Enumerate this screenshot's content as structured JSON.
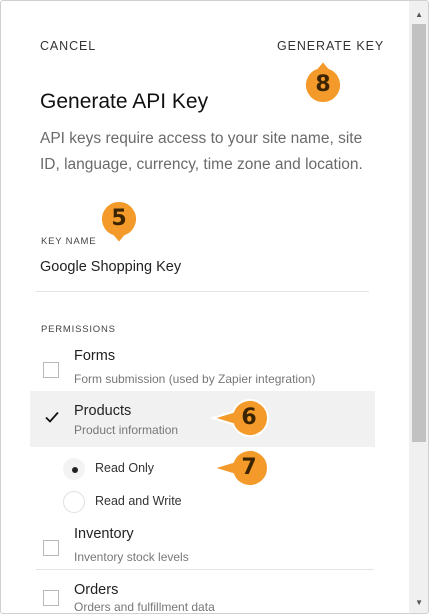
{
  "header": {
    "cancel_label": "CANCEL",
    "generate_label": "GENERATE KEY"
  },
  "title": "Generate API Key",
  "description": "API keys require access to your site name, site ID, language, currency, time zone and location.",
  "key_name": {
    "label": "KEY NAME",
    "value": "Google Shopping Key"
  },
  "permissions": {
    "label": "PERMISSIONS",
    "items": [
      {
        "title": "Forms",
        "subtitle": "Form submission (used by Zapier integration)",
        "checked": false
      },
      {
        "title": "Products",
        "subtitle": "Product information",
        "checked": true
      },
      {
        "title": "Inventory",
        "subtitle": "Inventory stock levels",
        "checked": false
      },
      {
        "title": "Orders",
        "subtitle": "Orders and fulfillment data",
        "checked": false
      }
    ],
    "access_options": [
      {
        "label": "Read Only",
        "selected": true
      },
      {
        "label": "Read and Write",
        "selected": false
      }
    ]
  },
  "callouts": [
    "8",
    "5",
    "6",
    "7"
  ],
  "colors": {
    "callout_fill": "#f39a2a",
    "callout_border": "#ffffff",
    "selected_row": "#f1f1f1",
    "scrollbar_thumb": "#c1c1c1"
  }
}
